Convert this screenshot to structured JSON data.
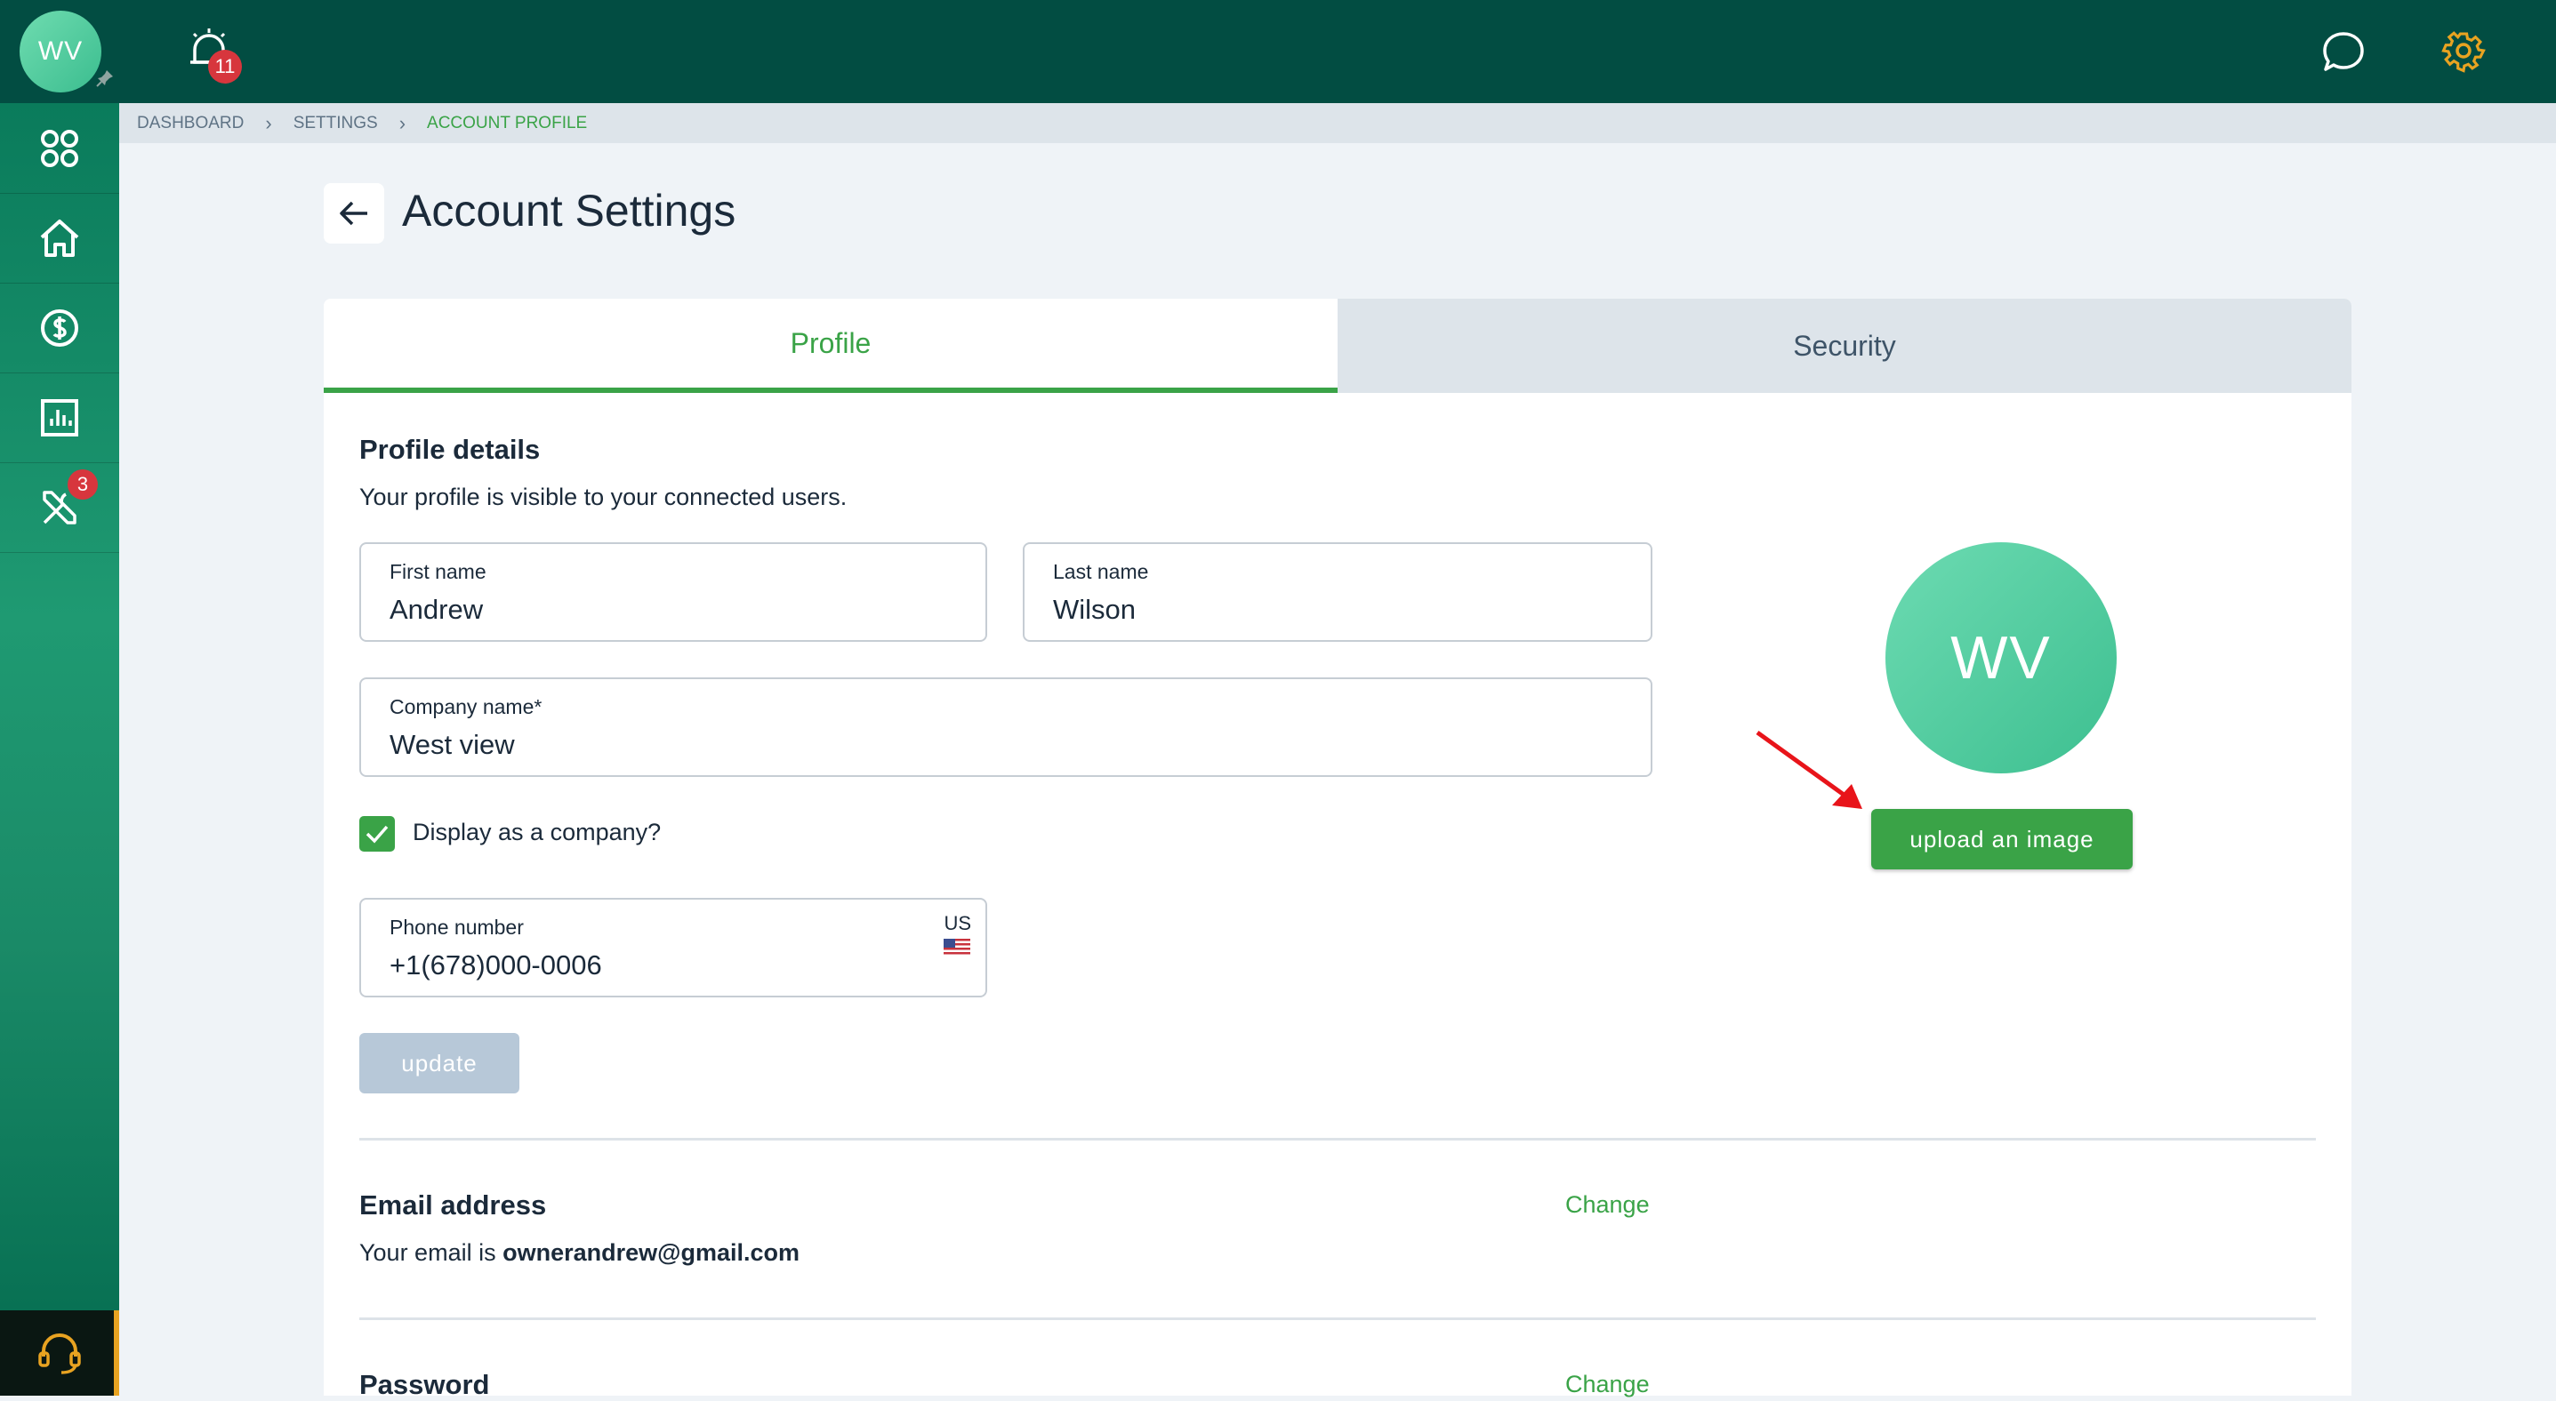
{
  "header": {
    "user_initials": "WV",
    "alarm_count": "11",
    "chat_icon": "chat-bubble-icon",
    "settings_icon": "gear-icon",
    "colors": {
      "bar": "#024d42",
      "gear": "#e8a321"
    }
  },
  "sidebar": {
    "items": [
      {
        "icon": "apps-grid-icon"
      },
      {
        "icon": "home-icon"
      },
      {
        "icon": "dollar-icon"
      },
      {
        "icon": "bar-chart-icon"
      },
      {
        "icon": "tools-icon",
        "badge": "3"
      }
    ],
    "support_icon": "headset-icon"
  },
  "breadcrumb": [
    "DASHBOARD",
    "SETTINGS",
    "ACCOUNT PROFILE"
  ],
  "page": {
    "title": "Account Settings"
  },
  "tabs": {
    "profile": "Profile",
    "security": "Security"
  },
  "profile": {
    "title": "Profile details",
    "subtitle": "Your profile is visible to your connected users.",
    "first_name": {
      "label": "First name",
      "value": "Andrew"
    },
    "last_name": {
      "label": "Last name",
      "value": "Wilson"
    },
    "company": {
      "label": "Company name*",
      "value": "West view"
    },
    "display_as_company": {
      "label": "Display as a company?",
      "checked": true
    },
    "phone": {
      "label": "Phone number",
      "value": "+1(678)000-0006",
      "country": "US"
    },
    "update_label": "update",
    "avatar_initials": "WV",
    "upload_label": "upload an image"
  },
  "email": {
    "title": "Email address",
    "prefix": "Your email is",
    "value": "ownerandrew@gmail.com",
    "change_label": "Change"
  },
  "password": {
    "title": "Password",
    "change_label": "Change"
  },
  "colors": {
    "accent": "#3aa347",
    "avatar": "#4fcf9e",
    "badge": "#d7363d"
  }
}
